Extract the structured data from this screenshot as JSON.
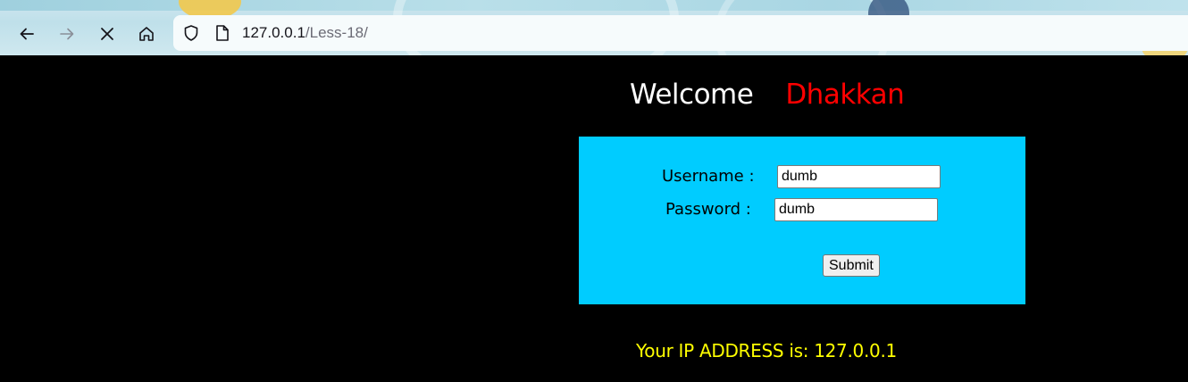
{
  "browser": {
    "url_host": "127.0.0.1",
    "url_path": "/Less-18/",
    "icons": [
      "back-icon",
      "forward-icon",
      "stop-icon",
      "home-icon",
      "shield-icon",
      "page-icon"
    ]
  },
  "page": {
    "welcome": "Welcome",
    "name": "Dhakkan",
    "username_label": "Username :",
    "password_label": "Password :",
    "username_value": "dumb",
    "password_value": "dumb",
    "submit_label": "Submit",
    "ip_text": "Your IP ADDRESS is: 127.0.0.1"
  },
  "colors": {
    "background": "#000000",
    "form_bg": "#00ccff",
    "name": "#ff0000",
    "ip_text": "#ffff00"
  }
}
